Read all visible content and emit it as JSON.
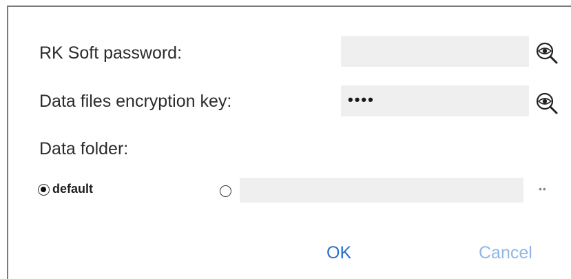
{
  "form": {
    "password_label": "RK Soft password:",
    "password_value": "",
    "key_label": "Data files encryption key:",
    "key_value": "••••",
    "folder_label": "Data folder:",
    "default_option_label": "default",
    "default_selected": true,
    "custom_path_value": "",
    "browse_label": "••"
  },
  "buttons": {
    "ok_label": "OK",
    "cancel_label": "Cancel"
  },
  "colors": {
    "field_bg": "#efefef",
    "ok_color": "#2a6fd0",
    "cancel_color": "#8fb7e6",
    "text": "#2b2b2b"
  },
  "icons": {
    "reveal_password": "eye-magnifier-icon",
    "reveal_key": "eye-magnifier-icon"
  }
}
